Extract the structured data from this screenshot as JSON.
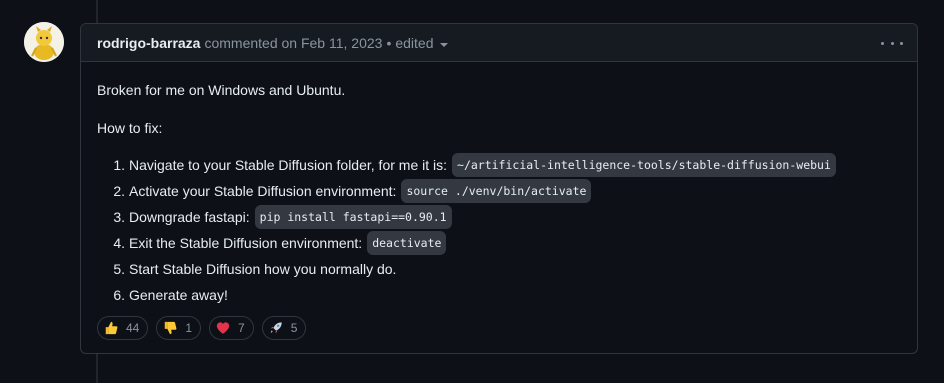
{
  "comment": {
    "author": "rodrigo-barraza",
    "meta": "commented on Feb 11, 2023",
    "separator": "•",
    "edited": "edited",
    "intro": "Broken for me on Windows and Ubuntu.",
    "howto": "How to fix:",
    "steps": [
      {
        "num": "1.",
        "text": "Navigate to your Stable Diffusion folder, for me it is:",
        "code": "~/artificial-intelligence-tools/stable-diffusion-webui"
      },
      {
        "num": "2.",
        "text": "Activate your Stable Diffusion environment:",
        "code": "source ./venv/bin/activate"
      },
      {
        "num": "3.",
        "text": "Downgrade fastapi:",
        "code": "pip install fastapi==0.90.1"
      },
      {
        "num": "4.",
        "text": "Exit the Stable Diffusion environment:",
        "code": "deactivate"
      },
      {
        "num": "5.",
        "text": "Start Stable Diffusion how you normally do.",
        "code": null
      },
      {
        "num": "6.",
        "text": "Generate away!",
        "code": null
      }
    ]
  },
  "reactions": [
    {
      "icon": "thumbs-up-icon",
      "count": "44"
    },
    {
      "icon": "thumbs-down-icon",
      "count": "1"
    },
    {
      "icon": "heart-icon",
      "count": "7"
    },
    {
      "icon": "rocket-icon",
      "count": "5"
    }
  ],
  "colors": {
    "background": "#0d1117",
    "header": "#161b22",
    "border": "#30363d",
    "text": "#e6edf3",
    "muted": "#8b949e"
  }
}
